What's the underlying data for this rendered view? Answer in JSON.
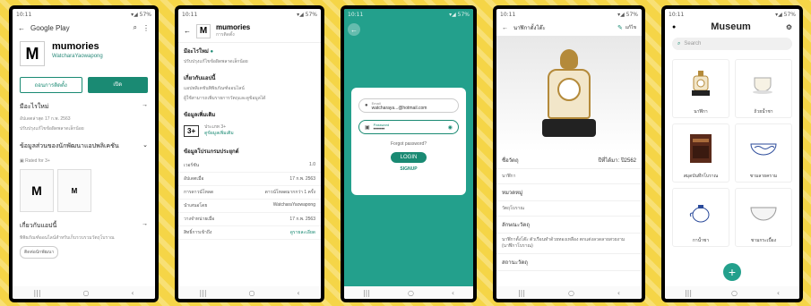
{
  "phones": {
    "p1": {
      "status": {
        "time": "10:11",
        "icons": "▾◢ 57%"
      },
      "store_title": "Google Play",
      "app_name": "mumories",
      "developer": "WatcharaYaowapong",
      "uninstall_label": "ถอนการติดตั้ง",
      "open_label": "เปิด",
      "whats_new": "มีอะไรใหม่",
      "whats_new_date": "อัปเดตล่าสุด 17 ก.พ. 2563",
      "whats_new_desc": "ปรับปรุงแก้ไขข้อผิดพลาดเล็กน้อย",
      "data_safety": "ข้อมูลส่วนของนักพัฒนาแอปพลิเคชัน",
      "rating_badge": "Rated for 3+",
      "thumb_1": "M",
      "thumb_2": "M",
      "about_title": "เกี่ยวกับแอปนี้",
      "about_desc": "พิพิธภัณฑ์ออนไลน์สำหรับเก็บรวบรวมวัตถุโบราณ",
      "chip": "ติดต่อนักพัฒนา"
    },
    "p2": {
      "status": {
        "time": "10:11",
        "icons": "▾◢ 57%"
      },
      "app_name": "mumories",
      "app_sub": "การติดตั้ง",
      "whats_new": "มีอะไรใหม่",
      "whats_new_desc": "ปรับปรุงแก้ไขข้อผิดพลาดเล็กน้อย",
      "about_title": "เกี่ยวกับแอปนี้",
      "about_desc": "แอปพลิเคชันพิพิธภัณฑ์ออนไลน์",
      "about_desc2": "ผู้ใช้สามารถเพิ่มรายการวัตถุและดูข้อมูลได้",
      "rating_title": "ข้อมูลเพิ่มเติม",
      "rating_value": "3+",
      "rating_text": "ประเภท 3+",
      "rating_link": "ดูข้อมูลเพิ่มเติม",
      "app_info_title": "ข้อมูลโปรแกรมประยุกต์",
      "app_info": [
        {
          "k": "เวอร์ชัน",
          "v": "1.0"
        },
        {
          "k": "อัปเดตเมื่อ",
          "v": "17 ก.พ. 2563"
        },
        {
          "k": "การดาวน์โหลด",
          "v": "ดาวน์โหลดมากกว่า 1 ครั้ง"
        },
        {
          "k": "นำเสนอโดย",
          "v": "WatcharaYaowapong"
        },
        {
          "k": "วางจำหน่ายเมื่อ",
          "v": "17 ก.พ. 2563"
        },
        {
          "k": "สิทธิ์การเข้าถึง",
          "v": "ดูรายละเอียด"
        }
      ]
    },
    "p3": {
      "status": {
        "time": "10:11",
        "icons": "▾◢ 57%"
      },
      "email_label": "Email",
      "email_value": "watcharaya...@hotmail.com",
      "password_label": "Password",
      "password_value": "••••••",
      "forgot": "Forgot password?",
      "login": "LOGIN",
      "signup": "SIGNUP"
    },
    "p4": {
      "status": {
        "time": "10:11",
        "icons": "▾◢ 57%"
      },
      "header_title": "นาฬิกาตั้งโต๊ะ",
      "edit_label": "แก้ไข",
      "object_label": "ชื่อวัตถุ",
      "year_label": "ปีที่ได้มา: ปี2562",
      "object_value": "นาฬิกา",
      "category_label": "หมวดหมู่",
      "category_value": "วัตถุโบราณ",
      "description_label": "ลักษณะวัตถุ",
      "description_text": "นาฬิกาตั้งโต๊ะ ตัวเรือนทำด้วยทองเหลือง ตกแต่งลวดลายสวยงาม (นาฬิกาโบราณ)",
      "source_label": "สถานะวัตถุ"
    },
    "p5": {
      "status": {
        "time": "10:11",
        "icons": "▾◢ 57%"
      },
      "title": "Museum",
      "search_placeholder": "Search",
      "items": [
        {
          "label": "นาฬิกา"
        },
        {
          "label": "ถ้วยน้ำชา"
        },
        {
          "label": "สมุดบันทึกโบราณ"
        },
        {
          "label": "ชามลายคราม"
        },
        {
          "label": "กาน้ำชา"
        },
        {
          "label": "ชามกระเบื้อง"
        }
      ],
      "fab": "+"
    }
  },
  "nav": {
    "recent": "|||",
    "home": "○",
    "back": "‹"
  }
}
